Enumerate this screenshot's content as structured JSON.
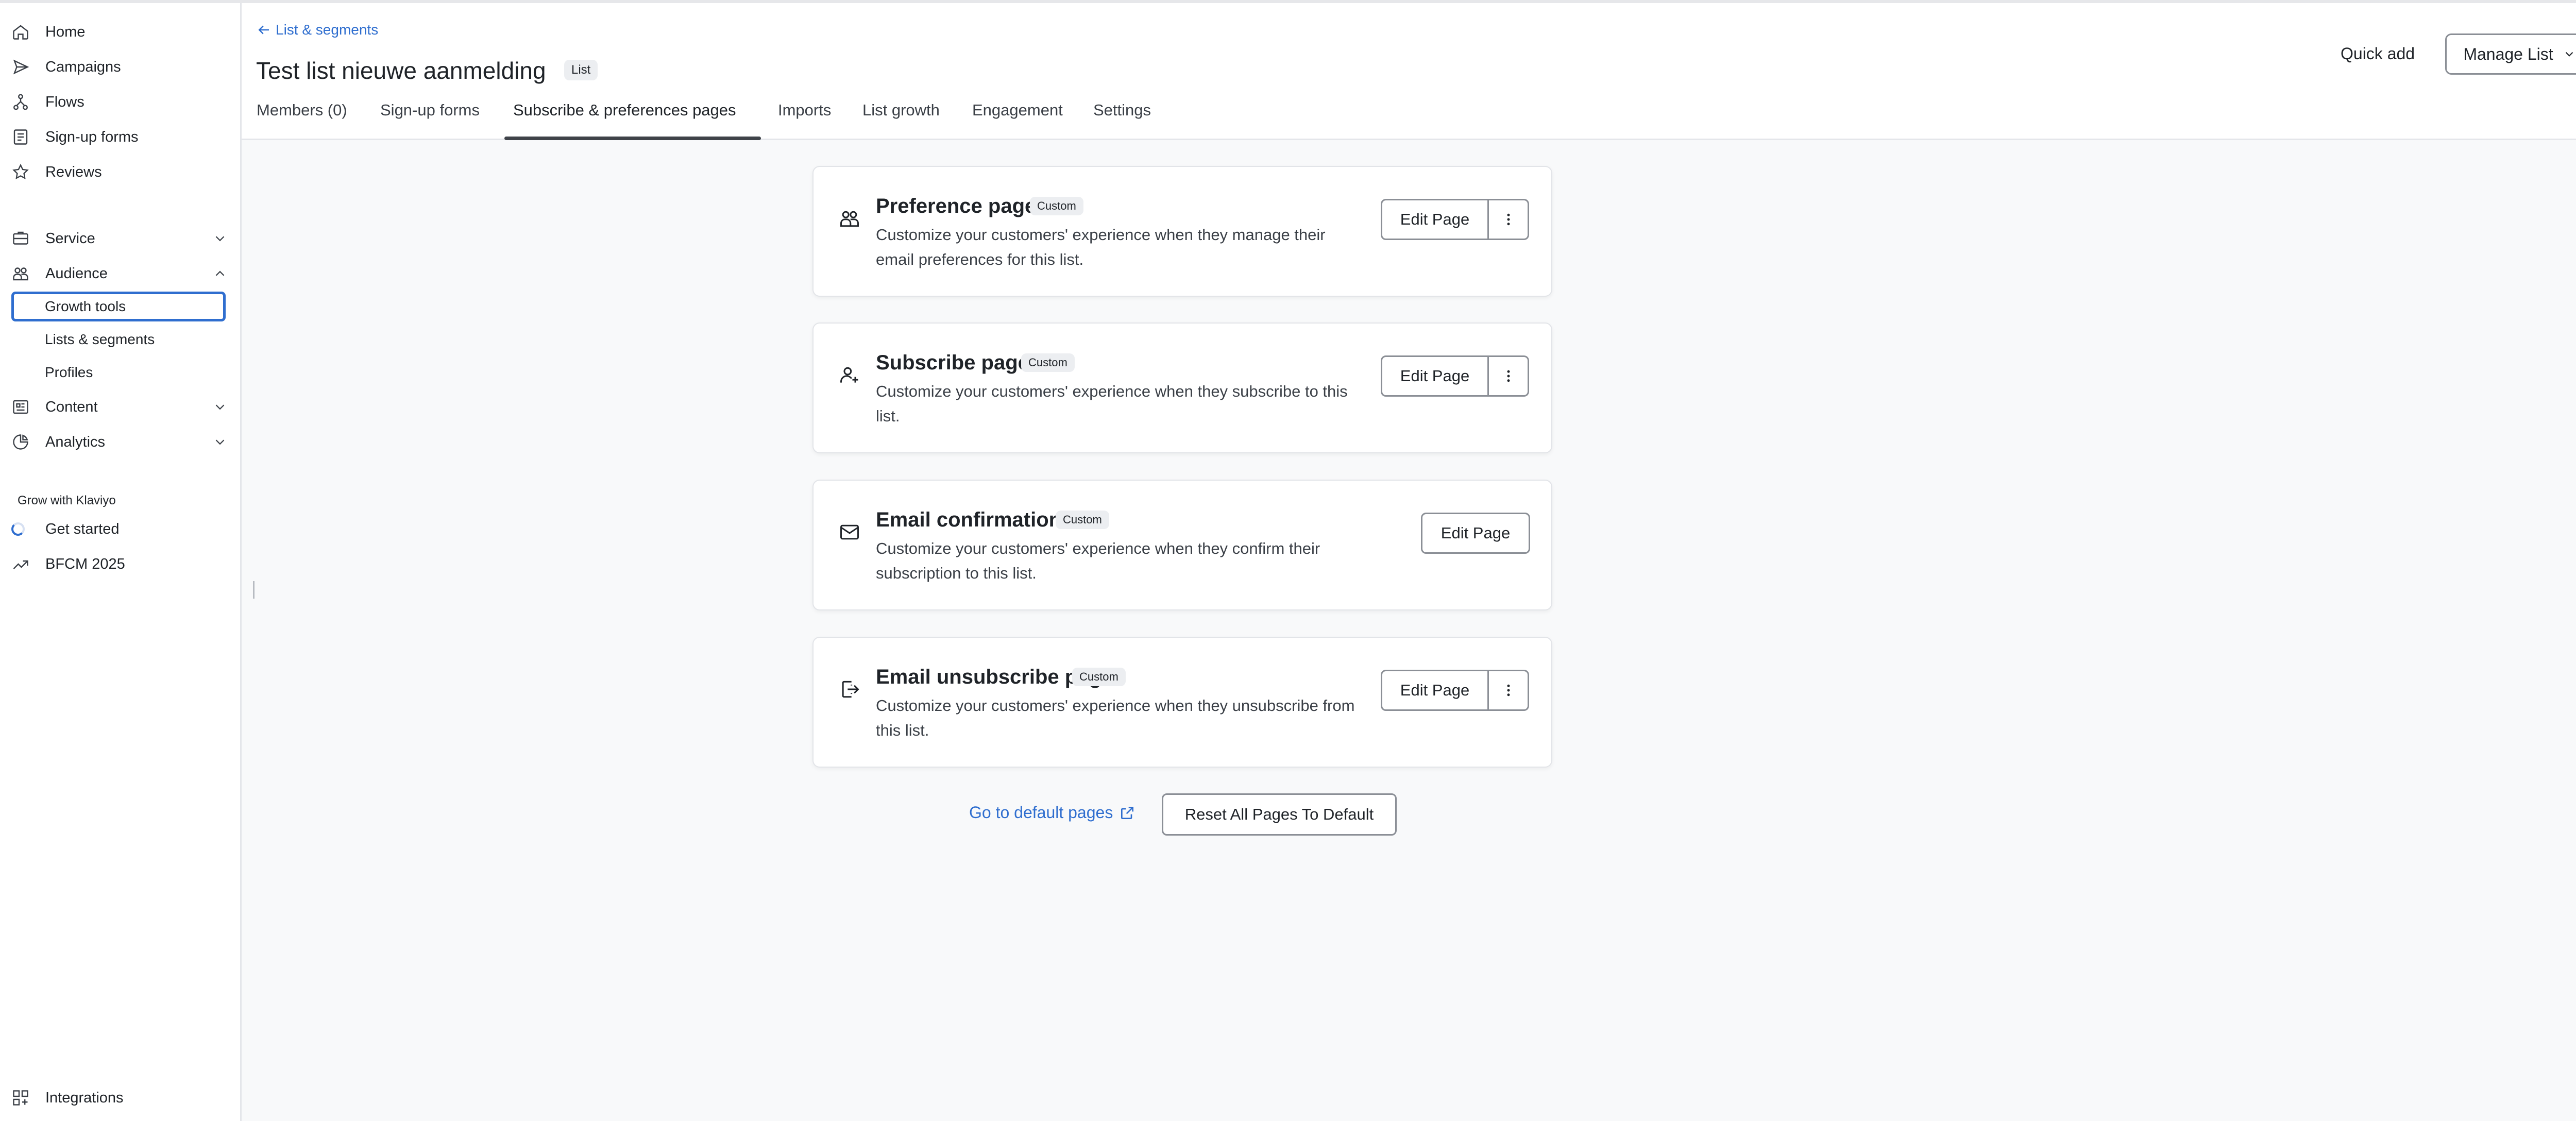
{
  "sidebar": {
    "main_items": [
      {
        "label": "Home",
        "icon": "home-icon"
      },
      {
        "label": "Campaigns",
        "icon": "send-icon"
      },
      {
        "label": "Flows",
        "icon": "flows-icon"
      },
      {
        "label": "Sign-up forms",
        "icon": "form-icon"
      },
      {
        "label": "Reviews",
        "icon": "star-icon"
      }
    ],
    "service": {
      "label": "Service",
      "icon": "service-icon"
    },
    "audience": {
      "label": "Audience",
      "icon": "audience-icon",
      "sub_items": [
        "Growth tools",
        "Lists & segments",
        "Profiles"
      ]
    },
    "content": {
      "label": "Content",
      "icon": "content-icon"
    },
    "analytics": {
      "label": "Analytics",
      "icon": "analytics-icon"
    },
    "grow_label": "Grow with Klaviyo",
    "get_started": "Get started",
    "bfcm": "BFCM 2025",
    "integrations": "Integrations"
  },
  "header": {
    "back_link": "List & segments",
    "title": "Test list nieuwe aanmelding",
    "title_badge": "List",
    "quick_add": "Quick add",
    "manage_list": "Manage List",
    "tabs": [
      "Members (0)",
      "Sign-up forms",
      "Subscribe & preferences pages",
      "Imports",
      "List growth",
      "Engagement",
      "Settings"
    ],
    "active_tab": "Subscribe & preferences pages"
  },
  "cards": [
    {
      "title": "Preference page",
      "badge": "Custom",
      "desc": "Customize your customers' experience when they manage their email preferences for this list.",
      "button": "Edit Page",
      "icon": "preferences-icon"
    },
    {
      "title": "Subscribe page",
      "badge": "Custom",
      "desc": "Customize your customers' experience when they subscribe to this list.",
      "button": "Edit Page",
      "icon": "user-add-icon"
    },
    {
      "title": "Email confirmation",
      "badge": "Custom",
      "desc": "Customize your customers' experience when they confirm their subscription to this list.",
      "button": "Edit Page",
      "icon": "envelope-icon"
    },
    {
      "title": "Email unsubscribe page",
      "badge": "Custom",
      "desc": "Customize your customers' experience when they unsubscribe from this list.",
      "button": "Edit Page",
      "icon": "logout-icon"
    }
  ],
  "footer": {
    "default_link": "Go to default pages",
    "reset_button": "Reset All Pages To Default"
  },
  "colors": {
    "accent": "#2f6ecf",
    "text": "#1f2328",
    "background": "#f8f9fa"
  }
}
